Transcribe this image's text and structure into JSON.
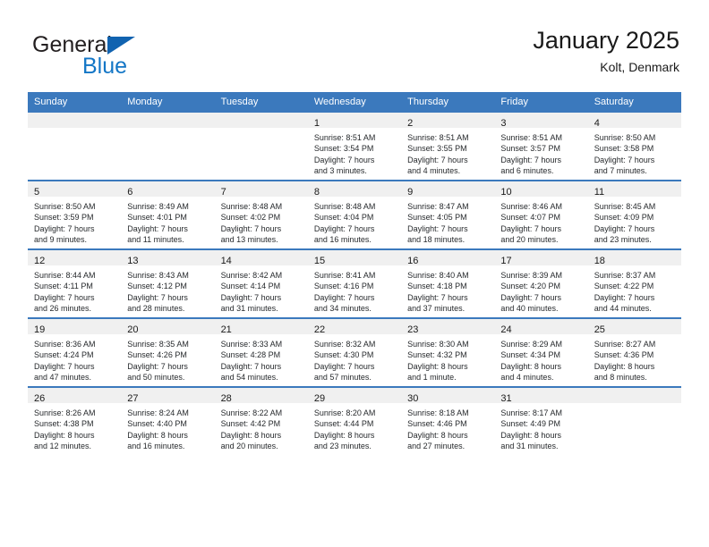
{
  "brand": {
    "name_part1": "General",
    "name_part2": "Blue",
    "triangle_color": "#1163b0",
    "blue_color": "#1376c6",
    "logo_icon": "triangle-icon"
  },
  "header": {
    "title": "January 2025",
    "subtitle": "Kolt, Denmark",
    "accent_color": "#3b79bd",
    "band_color": "#f0f0f0"
  },
  "calendar": {
    "columns": [
      "Sunday",
      "Monday",
      "Tuesday",
      "Wednesday",
      "Thursday",
      "Friday",
      "Saturday"
    ],
    "weeks": [
      [
        {
          "day": "",
          "lines": []
        },
        {
          "day": "",
          "lines": []
        },
        {
          "day": "",
          "lines": []
        },
        {
          "day": "1",
          "lines": [
            "Sunrise: 8:51 AM",
            "Sunset: 3:54 PM",
            "Daylight: 7 hours",
            "and 3 minutes."
          ]
        },
        {
          "day": "2",
          "lines": [
            "Sunrise: 8:51 AM",
            "Sunset: 3:55 PM",
            "Daylight: 7 hours",
            "and 4 minutes."
          ]
        },
        {
          "day": "3",
          "lines": [
            "Sunrise: 8:51 AM",
            "Sunset: 3:57 PM",
            "Daylight: 7 hours",
            "and 6 minutes."
          ]
        },
        {
          "day": "4",
          "lines": [
            "Sunrise: 8:50 AM",
            "Sunset: 3:58 PM",
            "Daylight: 7 hours",
            "and 7 minutes."
          ]
        }
      ],
      [
        {
          "day": "5",
          "lines": [
            "Sunrise: 8:50 AM",
            "Sunset: 3:59 PM",
            "Daylight: 7 hours",
            "and 9 minutes."
          ]
        },
        {
          "day": "6",
          "lines": [
            "Sunrise: 8:49 AM",
            "Sunset: 4:01 PM",
            "Daylight: 7 hours",
            "and 11 minutes."
          ]
        },
        {
          "day": "7",
          "lines": [
            "Sunrise: 8:48 AM",
            "Sunset: 4:02 PM",
            "Daylight: 7 hours",
            "and 13 minutes."
          ]
        },
        {
          "day": "8",
          "lines": [
            "Sunrise: 8:48 AM",
            "Sunset: 4:04 PM",
            "Daylight: 7 hours",
            "and 16 minutes."
          ]
        },
        {
          "day": "9",
          "lines": [
            "Sunrise: 8:47 AM",
            "Sunset: 4:05 PM",
            "Daylight: 7 hours",
            "and 18 minutes."
          ]
        },
        {
          "day": "10",
          "lines": [
            "Sunrise: 8:46 AM",
            "Sunset: 4:07 PM",
            "Daylight: 7 hours",
            "and 20 minutes."
          ]
        },
        {
          "day": "11",
          "lines": [
            "Sunrise: 8:45 AM",
            "Sunset: 4:09 PM",
            "Daylight: 7 hours",
            "and 23 minutes."
          ]
        }
      ],
      [
        {
          "day": "12",
          "lines": [
            "Sunrise: 8:44 AM",
            "Sunset: 4:11 PM",
            "Daylight: 7 hours",
            "and 26 minutes."
          ]
        },
        {
          "day": "13",
          "lines": [
            "Sunrise: 8:43 AM",
            "Sunset: 4:12 PM",
            "Daylight: 7 hours",
            "and 28 minutes."
          ]
        },
        {
          "day": "14",
          "lines": [
            "Sunrise: 8:42 AM",
            "Sunset: 4:14 PM",
            "Daylight: 7 hours",
            "and 31 minutes."
          ]
        },
        {
          "day": "15",
          "lines": [
            "Sunrise: 8:41 AM",
            "Sunset: 4:16 PM",
            "Daylight: 7 hours",
            "and 34 minutes."
          ]
        },
        {
          "day": "16",
          "lines": [
            "Sunrise: 8:40 AM",
            "Sunset: 4:18 PM",
            "Daylight: 7 hours",
            "and 37 minutes."
          ]
        },
        {
          "day": "17",
          "lines": [
            "Sunrise: 8:39 AM",
            "Sunset: 4:20 PM",
            "Daylight: 7 hours",
            "and 40 minutes."
          ]
        },
        {
          "day": "18",
          "lines": [
            "Sunrise: 8:37 AM",
            "Sunset: 4:22 PM",
            "Daylight: 7 hours",
            "and 44 minutes."
          ]
        }
      ],
      [
        {
          "day": "19",
          "lines": [
            "Sunrise: 8:36 AM",
            "Sunset: 4:24 PM",
            "Daylight: 7 hours",
            "and 47 minutes."
          ]
        },
        {
          "day": "20",
          "lines": [
            "Sunrise: 8:35 AM",
            "Sunset: 4:26 PM",
            "Daylight: 7 hours",
            "and 50 minutes."
          ]
        },
        {
          "day": "21",
          "lines": [
            "Sunrise: 8:33 AM",
            "Sunset: 4:28 PM",
            "Daylight: 7 hours",
            "and 54 minutes."
          ]
        },
        {
          "day": "22",
          "lines": [
            "Sunrise: 8:32 AM",
            "Sunset: 4:30 PM",
            "Daylight: 7 hours",
            "and 57 minutes."
          ]
        },
        {
          "day": "23",
          "lines": [
            "Sunrise: 8:30 AM",
            "Sunset: 4:32 PM",
            "Daylight: 8 hours",
            "and 1 minute."
          ]
        },
        {
          "day": "24",
          "lines": [
            "Sunrise: 8:29 AM",
            "Sunset: 4:34 PM",
            "Daylight: 8 hours",
            "and 4 minutes."
          ]
        },
        {
          "day": "25",
          "lines": [
            "Sunrise: 8:27 AM",
            "Sunset: 4:36 PM",
            "Daylight: 8 hours",
            "and 8 minutes."
          ]
        }
      ],
      [
        {
          "day": "26",
          "lines": [
            "Sunrise: 8:26 AM",
            "Sunset: 4:38 PM",
            "Daylight: 8 hours",
            "and 12 minutes."
          ]
        },
        {
          "day": "27",
          "lines": [
            "Sunrise: 8:24 AM",
            "Sunset: 4:40 PM",
            "Daylight: 8 hours",
            "and 16 minutes."
          ]
        },
        {
          "day": "28",
          "lines": [
            "Sunrise: 8:22 AM",
            "Sunset: 4:42 PM",
            "Daylight: 8 hours",
            "and 20 minutes."
          ]
        },
        {
          "day": "29",
          "lines": [
            "Sunrise: 8:20 AM",
            "Sunset: 4:44 PM",
            "Daylight: 8 hours",
            "and 23 minutes."
          ]
        },
        {
          "day": "30",
          "lines": [
            "Sunrise: 8:18 AM",
            "Sunset: 4:46 PM",
            "Daylight: 8 hours",
            "and 27 minutes."
          ]
        },
        {
          "day": "31",
          "lines": [
            "Sunrise: 8:17 AM",
            "Sunset: 4:49 PM",
            "Daylight: 8 hours",
            "and 31 minutes."
          ]
        },
        {
          "day": "",
          "lines": []
        }
      ]
    ]
  }
}
